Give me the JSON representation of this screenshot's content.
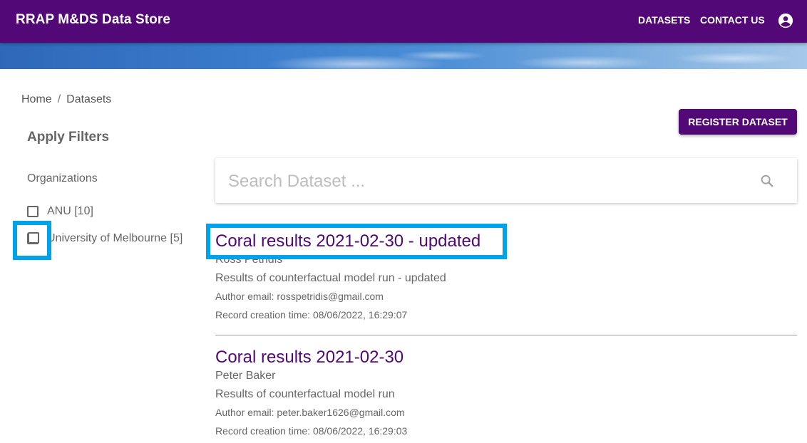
{
  "app": {
    "title": "RRAP M&DS Data Store",
    "nav": [
      {
        "label": "DATASETS"
      },
      {
        "label": "CONTACT US"
      }
    ],
    "account_icon": "account-circle-icon",
    "brand_color": "#520877"
  },
  "breadcrumb": {
    "items": [
      "Home",
      "Datasets"
    ],
    "separator": "/"
  },
  "actions": {
    "register_label": "REGISTER DATASET"
  },
  "filters": {
    "title": "Apply Filters",
    "group_label": "Organizations",
    "options": [
      {
        "label": "ANU [10]",
        "checked": false
      },
      {
        "label": "University of Melbourne [5]",
        "checked": false
      }
    ]
  },
  "search": {
    "placeholder": "Search Dataset ...",
    "value": "",
    "icon": "search-icon"
  },
  "datasets": [
    {
      "title": "Coral results 2021-02-30 - updated",
      "author": "Ross Petridis",
      "description": "Results of counterfactual model run - updated",
      "author_email": "Author email: rosspetridis@gmail.com",
      "created": "Record creation time: 08/06/2022, 16:29:07"
    },
    {
      "title": "Coral results 2021-02-30",
      "author": "Peter Baker",
      "description": "Results of counterfactual model run",
      "author_email": "Author email: peter.baker1626@gmail.com",
      "created": "Record creation time: 08/06/2022, 16:29:03"
    }
  ],
  "highlight_color": "#00a2e8"
}
